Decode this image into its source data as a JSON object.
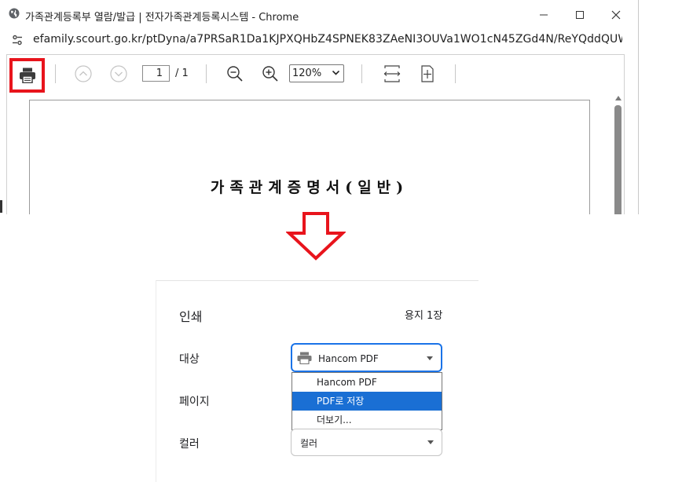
{
  "window": {
    "title": "가족관계등록부 열람/발급 | 전자가족관계등록시스템 - Chrome",
    "url": "efamily.scourt.go.kr/ptDyna/a7PRSaR1Da1KJPXQHbZ4SPNEK83ZAeNI3OUVa1WO1cN45ZGd4N/ReYQddQUWSMdQ..."
  },
  "pdf_toolbar": {
    "page_current": "1",
    "page_total": "/  1",
    "zoom": "120%",
    "highlight_color": "#e8141c"
  },
  "document": {
    "title": "가족관계증명서(일반)"
  },
  "print_dialog": {
    "title": "인쇄",
    "sheets": "용지 1장",
    "destination_label": "대상",
    "destination_value": "Hancom PDF",
    "destination_options": [
      "Hancom PDF",
      "PDF로 저장",
      "더보기..."
    ],
    "selected_option_index": 1,
    "pages_label": "페이지",
    "color_label": "컬러",
    "color_value": "컬러",
    "accent_color": "#1a73e8"
  }
}
